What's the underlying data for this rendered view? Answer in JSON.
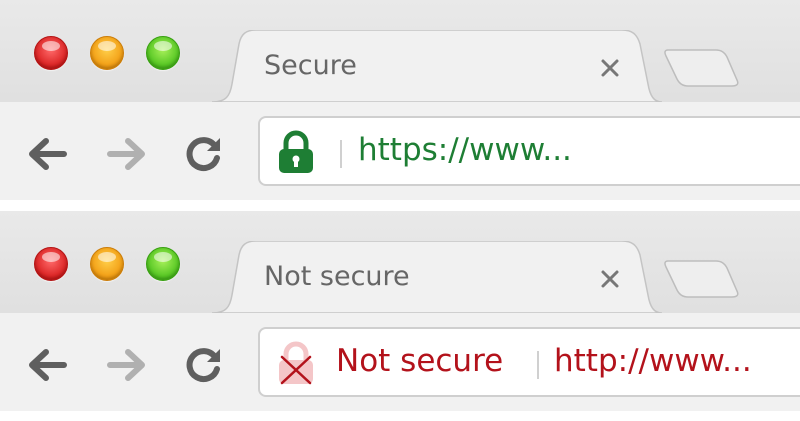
{
  "colors": {
    "secure_green": "#1e7e34",
    "insecure_red": "#b3121b",
    "tab_text": "#666666",
    "icon_gray": "#666666"
  },
  "browsers": [
    {
      "tab": {
        "title": "Secure"
      },
      "address_bar": {
        "state": "secure",
        "icon": "lock-icon",
        "status_label": "",
        "url": "https://www..."
      }
    },
    {
      "tab": {
        "title": "Not secure"
      },
      "address_bar": {
        "state": "not-secure",
        "icon": "broken-lock-icon",
        "status_label": "Not secure",
        "url": "http://www..."
      }
    }
  ]
}
